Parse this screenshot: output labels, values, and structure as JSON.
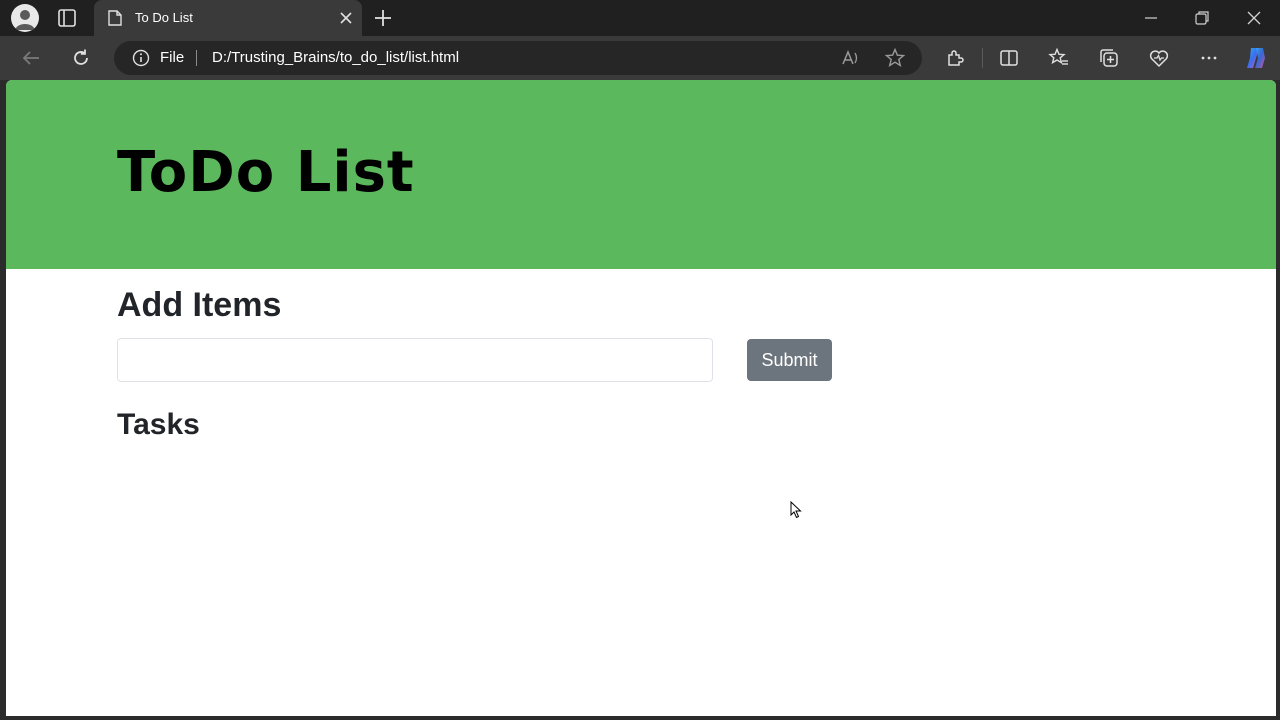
{
  "browser": {
    "tab": {
      "title": "To Do List"
    },
    "address": {
      "scheme_label": "File",
      "url": "D:/Trusting_Brains/to_do_list/list.html"
    }
  },
  "page": {
    "hero_title": "ToDo List",
    "add_heading": "Add Items",
    "input": {
      "value": "",
      "placeholder": ""
    },
    "submit_label": "Submit",
    "tasks_heading": "Tasks"
  },
  "colors": {
    "hero_bg": "#5cb85c",
    "button_bg": "#6c757d",
    "chrome_dark": "#202020",
    "toolbar": "#3a3a3a"
  }
}
